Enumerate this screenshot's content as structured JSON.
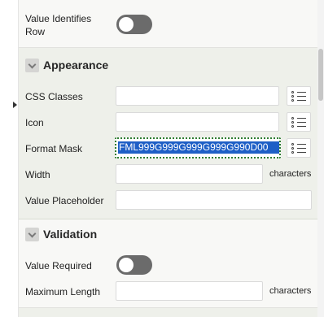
{
  "top": {
    "value_identifies_row_label_line1": "Value Identifies",
    "value_identifies_row_label_line2": "Row"
  },
  "appearance": {
    "heading": "Appearance",
    "css_classes_label": "CSS Classes",
    "icon_label": "Icon",
    "format_mask_label": "Format Mask",
    "format_mask_value": "FML999G999G999G999G990D00",
    "width_label": "Width",
    "width_suffix": "characters",
    "value_placeholder_label": "Value Placeholder"
  },
  "validation": {
    "heading": "Validation",
    "value_required_label": "Value Required",
    "maximum_length_label": "Maximum Length",
    "maximum_length_suffix": "characters"
  },
  "icons": {
    "section_toggle": "chevron-down-icon",
    "lov": "list-icon",
    "panel_collapse": "caret-right-icon"
  },
  "colors": {
    "section_band": "#eef0ea",
    "toggle_off": "#6b6b6b",
    "selection": "#1e5fc6",
    "focus_outline": "#2f7d32"
  }
}
